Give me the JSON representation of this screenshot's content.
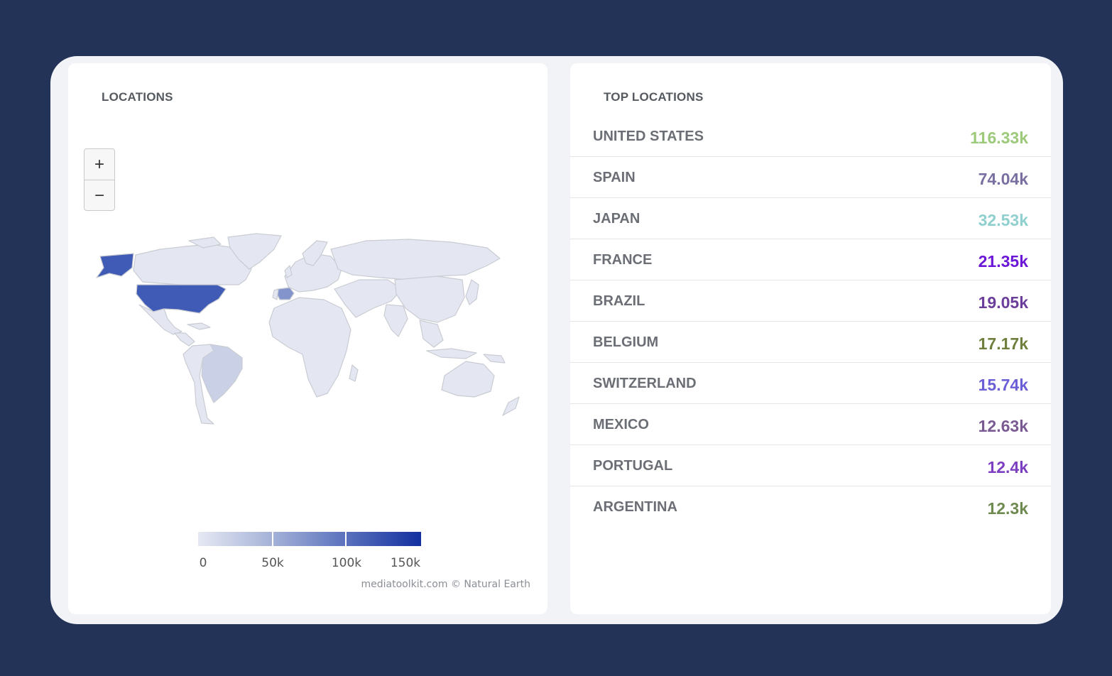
{
  "locations_panel": {
    "title": "LOCATIONS",
    "zoom_in_label": "+",
    "zoom_out_label": "−",
    "legend": {
      "labels": [
        "0",
        "50k",
        "100k",
        "150k"
      ],
      "max": 150000
    },
    "credit": "mediatoolkit.com © Natural Earth",
    "colors": {
      "low": "#e6e9f3",
      "high": "#12309f",
      "country_fill": "#e4e7f1",
      "border": "#c9ccd3"
    },
    "highlighted_countries": [
      {
        "name": "United States",
        "value": 116330,
        "color": "#3f5bb5"
      },
      {
        "name": "Spain",
        "value": 74040,
        "color": "#8394cc"
      },
      {
        "name": "Brazil",
        "value": 19050,
        "color": "#cad1e7"
      }
    ]
  },
  "top_locations_panel": {
    "title": "TOP LOCATIONS",
    "items": [
      {
        "name": "UNITED STATES",
        "value": "116.33k",
        "color": "#9cc97a"
      },
      {
        "name": "SPAIN",
        "value": "74.04k",
        "color": "#7a6fa0"
      },
      {
        "name": "JAPAN",
        "value": "32.53k",
        "color": "#8fcfce"
      },
      {
        "name": "FRANCE",
        "value": "21.35k",
        "color": "#6c17d8"
      },
      {
        "name": "BRAZIL",
        "value": "19.05k",
        "color": "#6a3e9a"
      },
      {
        "name": "BELGIUM",
        "value": "17.17k",
        "color": "#6f7f3d"
      },
      {
        "name": "SWITZERLAND",
        "value": "15.74k",
        "color": "#6a5fd6"
      },
      {
        "name": "MEXICO",
        "value": "12.63k",
        "color": "#7a5a92"
      },
      {
        "name": "PORTUGAL",
        "value": "12.4k",
        "color": "#7d3fc2"
      },
      {
        "name": "ARGENTINA",
        "value": "12.3k",
        "color": "#6e8a4e"
      }
    ]
  }
}
